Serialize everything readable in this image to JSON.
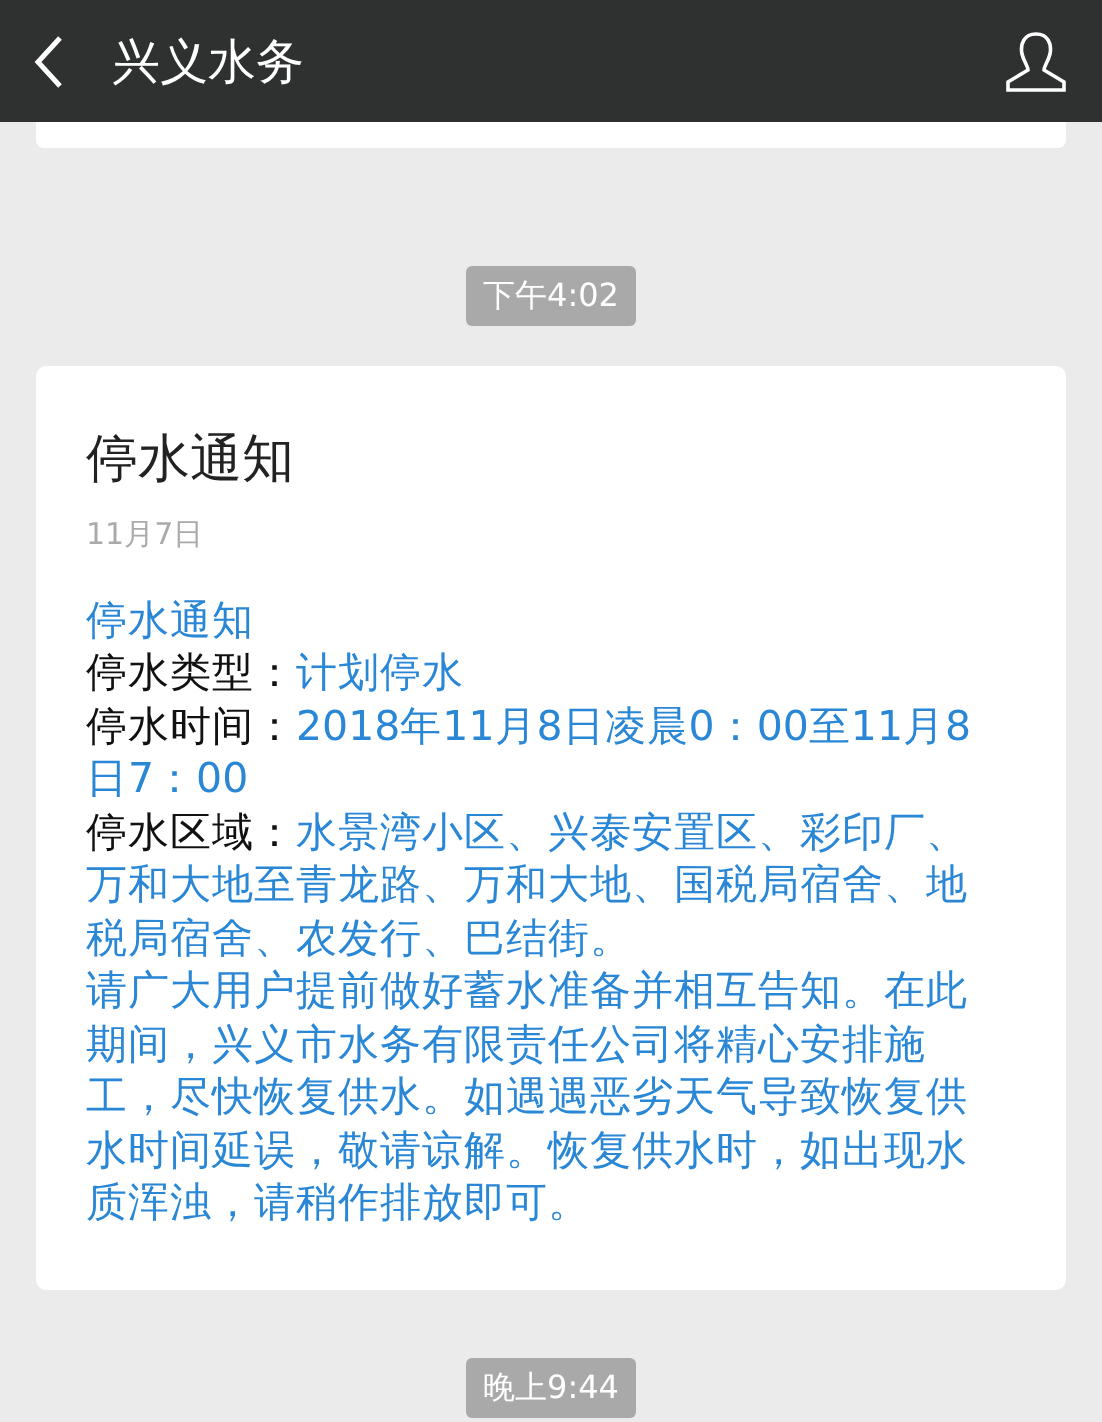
{
  "header": {
    "title": "兴义水务"
  },
  "messages": [
    {
      "time": "下午4:02",
      "title": "停水通知",
      "date": "11月7日",
      "content": [
        {
          "kind": "heading",
          "text": "停水通知"
        },
        {
          "kind": "field",
          "label": "停水类型：",
          "value": "计划停水"
        },
        {
          "kind": "field",
          "label": "停水时间：",
          "value": "2018年11月8日凌晨0：00至11月8日7：00"
        },
        {
          "kind": "field",
          "label": "停水区域：",
          "value": "水景湾小区、兴泰安置区、彩印厂、万和大地至青龙路、万和大地、国税局宿舍、地税局宿舍、农发行、巴结街。"
        },
        {
          "kind": "paragraph",
          "text": "请广大用户提前做好蓄水准备并相互告知。在此期间，兴义市水务有限责任公司将精心安排施工，尽快恢复供水。如遇遇恶劣天气导致恢复供水时间延误，敬请谅解。恢复供水时，如出现水质浑浊，请稍作排放即可。"
        }
      ]
    }
  ],
  "next_time": "晚上9:44"
}
